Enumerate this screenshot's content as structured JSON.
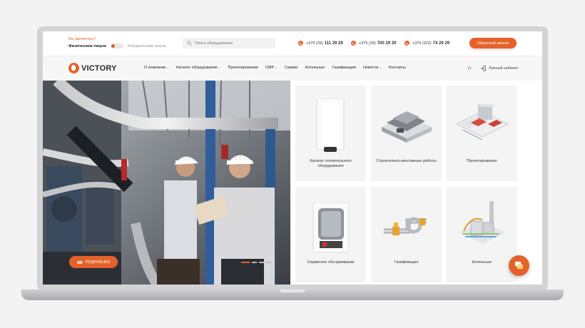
{
  "topbar": {
    "who_question": "Вы являетесь?",
    "who_individual": "Физическим лицом",
    "who_legal": "Юридическим лицом",
    "search_placeholder": "Поиск оборудования",
    "phones": [
      {
        "prefix": "+375 (29)",
        "number": "111 29 29"
      },
      {
        "prefix": "+375 (29)",
        "number": "700 29 29"
      },
      {
        "prefix": "+375 (222)",
        "number": "74 29 29"
      }
    ],
    "callback_label": "Обратный звонок"
  },
  "nav": {
    "logo_text": "VICTORY",
    "items": [
      "О компании",
      "Каталог оборудования",
      "Проектирование",
      "СМР",
      "Сервис",
      "Котельные",
      "Газификация",
      "Новости",
      "Контакты"
    ],
    "cabinet_label": "Личный кабинет"
  },
  "hero": {
    "more_label": "ПОДРОБНЕЕ"
  },
  "cards": [
    {
      "label": "Каталог отопительного оборудования",
      "icon": "boiler-icon"
    },
    {
      "label": "Строительно-монтажные работы",
      "icon": "building-icon"
    },
    {
      "label": "Проектирование",
      "icon": "floorplan-icon"
    },
    {
      "label": "Сервисное обслуживание",
      "icon": "boiler-open-icon"
    },
    {
      "label": "Газификация",
      "icon": "pipes-icon"
    },
    {
      "label": "Котельные",
      "icon": "boiler-room-icon"
    }
  ],
  "colors": {
    "accent": "#e4622a"
  }
}
